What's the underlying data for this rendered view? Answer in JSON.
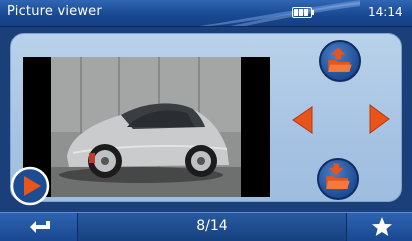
{
  "header": {
    "title": "Picture viewer",
    "clock": "14:14",
    "battery_icon": "battery-icon"
  },
  "viewer": {
    "image_description_icon": "photo",
    "prev_folder_icon": "folder-up-icon",
    "next_folder_icon": "folder-down-icon",
    "prev_icon": "arrow-left-icon",
    "next_icon": "arrow-right-icon",
    "slideshow_icon": "play-icon"
  },
  "footer": {
    "counter": "8/14",
    "back_icon": "back-arrow-icon",
    "favorite_icon": "star-icon"
  },
  "colors": {
    "accent_orange": "#e8541a",
    "bar_blue": "#1a4a94",
    "panel_blue": "#a7c3e3"
  }
}
